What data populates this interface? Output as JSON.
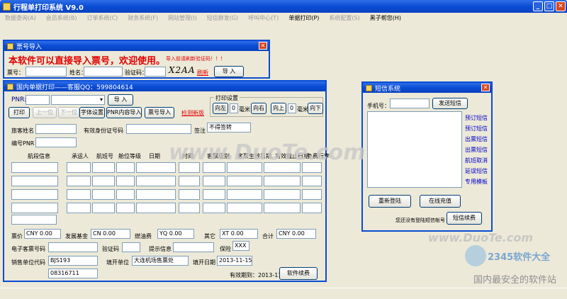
{
  "app": {
    "title": "行程单打印系统 V9.0"
  },
  "menu": [
    {
      "label": "数据查询(A)",
      "on": false
    },
    {
      "label": "会员系统(B)",
      "on": false
    },
    {
      "label": "订单系统(C)",
      "on": false
    },
    {
      "label": "财务系统(F)",
      "on": false
    },
    {
      "label": "网站管理(I)",
      "on": false
    },
    {
      "label": "短信群发(G)",
      "on": false
    },
    {
      "label": "呼叫中心(T)",
      "on": false
    },
    {
      "label": "单据打印(P)",
      "on": true
    },
    {
      "label": "系统配置(S)",
      "on": false
    },
    {
      "label": "黑子帮您(H)",
      "on": true
    }
  ],
  "ticket_import": {
    "title": "票号导入",
    "banner": "本软件可以直接导入票号，欢迎使用。",
    "hint": "导入前请刷新验证码！！！",
    "ticket_label": "票号：",
    "name_label": "姓名：",
    "captcha_label": "验证码：",
    "captcha_image": "X2AA",
    "refresh": "刷新",
    "import_btn": "导 入"
  },
  "domestic": {
    "title": "国内单据打印——客服QQ：599804614",
    "pnr_label": "PNR:",
    "import_btn": "导 入",
    "print_btn": "打印",
    "prev_btn": "上一位",
    "next_btn": "下一位",
    "font_btn": "字体设置",
    "pnr_import_btn": "PNR内容导入",
    "ticket_import_btn": "票号导入",
    "update_link": "检测新版",
    "print_settings": {
      "legend": "打印设置",
      "left": "向左",
      "right": "向右",
      "up": "向上",
      "down": "向下",
      "h_value": "0",
      "v_value": "0",
      "unit": "毫米"
    },
    "passenger_label": "旅客姓名",
    "id_label": "有效身份证号码",
    "remark_label": "签注",
    "remark_value": "不得签转",
    "pnr_code_label": "编号PNR",
    "columns": [
      "航段信息",
      "承运人",
      "航班号",
      "舱位等级",
      "日期",
      "时间",
      "客票级别",
      "客票生效日期",
      "有效截止日期",
      "免费行李"
    ],
    "fare_label": "票价",
    "fare_value": "CNY 0.00",
    "fund_label": "发展基金",
    "fund_value": "CN 0.00",
    "fuel_label": "燃油费",
    "fuel_value": "YQ 0.00",
    "other_label": "其它",
    "other_value": "XT 0.00",
    "total_label": "合计",
    "total_value": "CNY 0.00",
    "eticket_label": "电子客票号码",
    "verify_label": "验证码",
    "info_label": "提示信息",
    "insurance_label": "保险",
    "insurance_value": "XXX",
    "agent_label": "销售单位代码",
    "agent_value": "BJS193",
    "issuer_label": "填开单位",
    "issuer_value": "大连机场售票处",
    "issue_date_label": "填开日期",
    "issue_date_value": "2013-11-15",
    "phone_value": "08316711",
    "expiry_text": "有效期到：2013-11-15",
    "renew_btn": "软件续费"
  },
  "sms": {
    "title": "短信系统",
    "phone_label": "手机号：",
    "send_btn": "发送短信",
    "links": [
      "预订短信",
      "预订短信",
      "出票短信",
      "出票短信",
      "航班取消",
      "延误短信",
      "专用模板"
    ],
    "relogin_btn": "重新登陆",
    "recharge_btn": "在线充值",
    "balance_text": "您还没有登陆短信帐号",
    "renew_btn": "短信续费"
  },
  "watermark": {
    "text": "2345软件大全",
    "sub": "国内最安全的软件站",
    "site": "www.DuoTe.com"
  }
}
